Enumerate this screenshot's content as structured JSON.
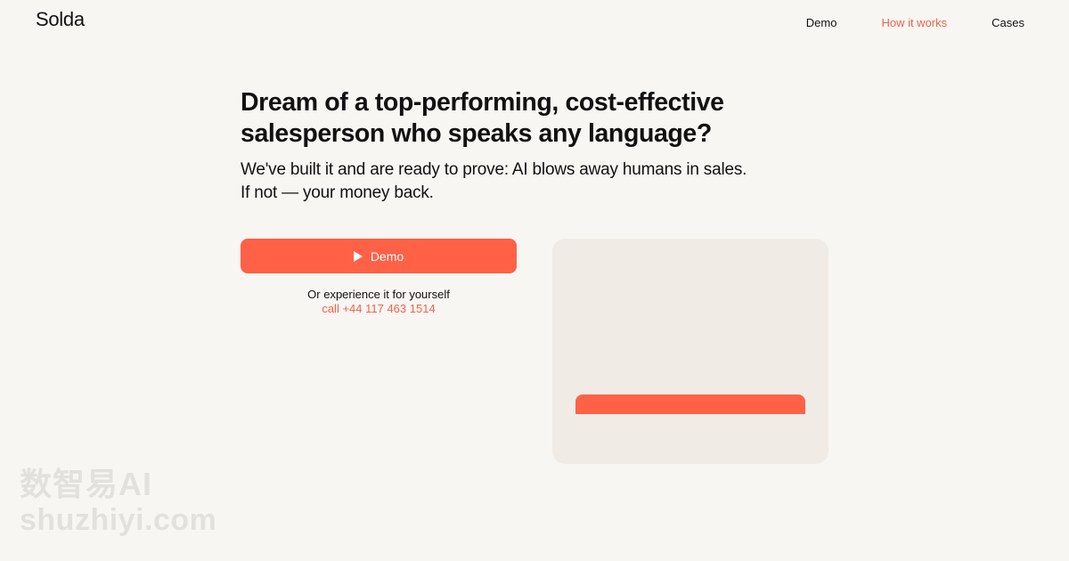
{
  "header": {
    "logo": "Solda",
    "nav": [
      {
        "label": "Demo"
      },
      {
        "label": "How it works"
      },
      {
        "label": "Cases"
      }
    ]
  },
  "hero": {
    "title": "Dream of a top-performing, cost-effective salesperson who speaks any language?",
    "subtitle_line1": "We've built it and are ready to prove: AI blows away humans in sales.",
    "subtitle_line2": "If not — your money back."
  },
  "cta": {
    "demo_label": "Demo",
    "demo_icon": "play-icon",
    "alt_text": "Or experience it for yourself",
    "call_label": "call +44 117 463 1514"
  },
  "watermark": {
    "line1": "数智易AI",
    "line2": "shuzhiyi.com"
  },
  "colors": {
    "background": "#f8f6f3",
    "accent": "#ff6146",
    "link_accent": "#f2634a",
    "card": "#f0ece5",
    "text": "#111111"
  }
}
